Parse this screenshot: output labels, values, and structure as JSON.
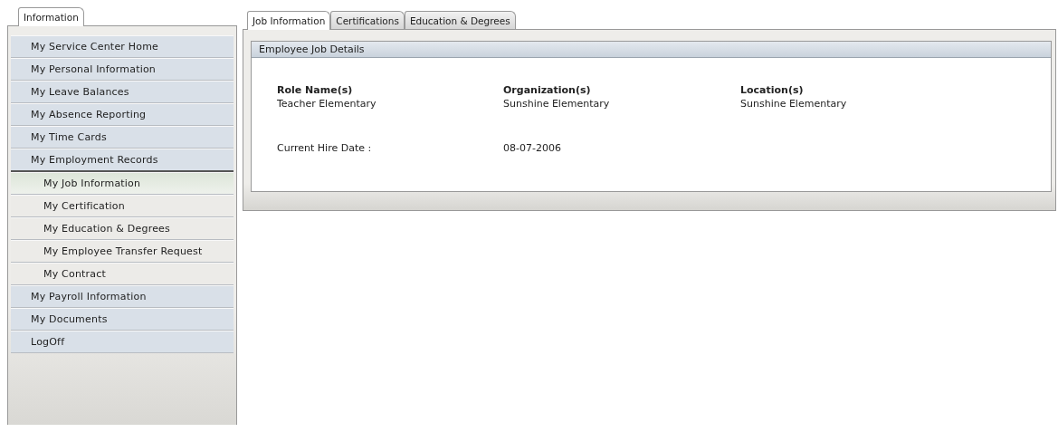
{
  "sidebar": {
    "tab": {
      "label": "Information",
      "selected": true
    },
    "items": [
      {
        "label": "My Service Center Home",
        "selected": false
      },
      {
        "label": "My Personal Information",
        "selected": false
      },
      {
        "label": "My Leave Balances",
        "selected": false
      },
      {
        "label": "My Absence Reporting",
        "selected": false
      },
      {
        "label": "My Time Cards",
        "selected": false
      },
      {
        "label": "My Employment Records",
        "selected": false,
        "expanded": true,
        "children": [
          {
            "label": "My Job Information",
            "selected": true
          },
          {
            "label": "My Certification",
            "selected": false
          },
          {
            "label": "My Education & Degrees",
            "selected": false
          },
          {
            "label": "My Employee Transfer Request",
            "selected": false
          },
          {
            "label": "My Contract",
            "selected": false
          }
        ]
      },
      {
        "label": "My Payroll Information",
        "selected": false
      },
      {
        "label": "My Documents",
        "selected": false
      },
      {
        "label": "LogOff",
        "selected": false
      }
    ]
  },
  "tabs": [
    {
      "label": "Job Information",
      "selected": true
    },
    {
      "label": "Certifications",
      "selected": false
    },
    {
      "label": "Education & Degrees",
      "selected": false
    }
  ],
  "section": {
    "title": "Employee Job Details",
    "columns": [
      {
        "heading": "Role Name(s)",
        "value": "Teacher Elementary"
      },
      {
        "heading": "Organization(s)",
        "value": "Sunshine Elementary"
      },
      {
        "heading": "Location(s)",
        "value": "Sunshine Elementary"
      }
    ],
    "hire_date": {
      "label": "Current Hire Date :",
      "value": "08-07-2006"
    }
  }
}
